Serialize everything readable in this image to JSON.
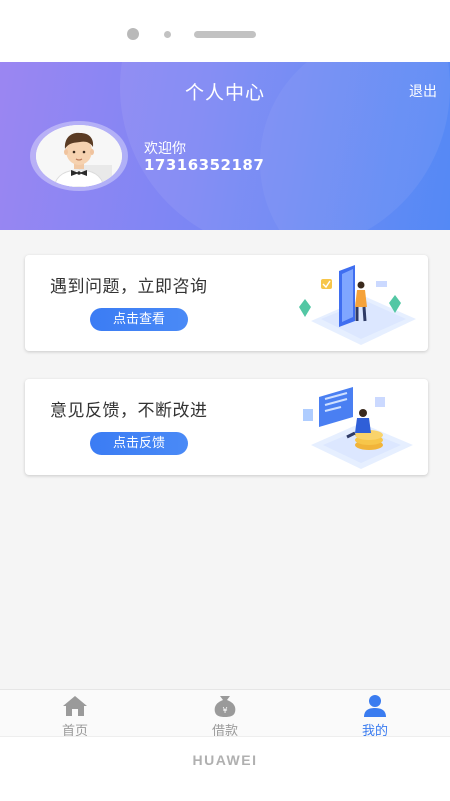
{
  "header": {
    "title": "个人中心",
    "logout_label": "退出",
    "welcome_text": "欢迎你",
    "phone_number": "17316352187"
  },
  "cards": [
    {
      "title": "遇到问题，立即咨询",
      "button_label": "点击查看",
      "illustration": "consult-illustration"
    },
    {
      "title": "意见反馈，不断改进",
      "button_label": "点击反馈",
      "illustration": "feedback-illustration"
    }
  ],
  "tabbar": {
    "tabs": [
      {
        "label": "首页",
        "icon": "home-icon",
        "active": false
      },
      {
        "label": "借款",
        "icon": "money-bag-icon",
        "active": false
      },
      {
        "label": "我的",
        "icon": "user-icon",
        "active": true
      }
    ]
  },
  "device": {
    "brand": "HUAWEI"
  },
  "colors": {
    "accent": "#3a7cf0",
    "header_start": "#9b86f2",
    "header_end": "#4b83f5",
    "inactive": "#9a9a9a"
  }
}
